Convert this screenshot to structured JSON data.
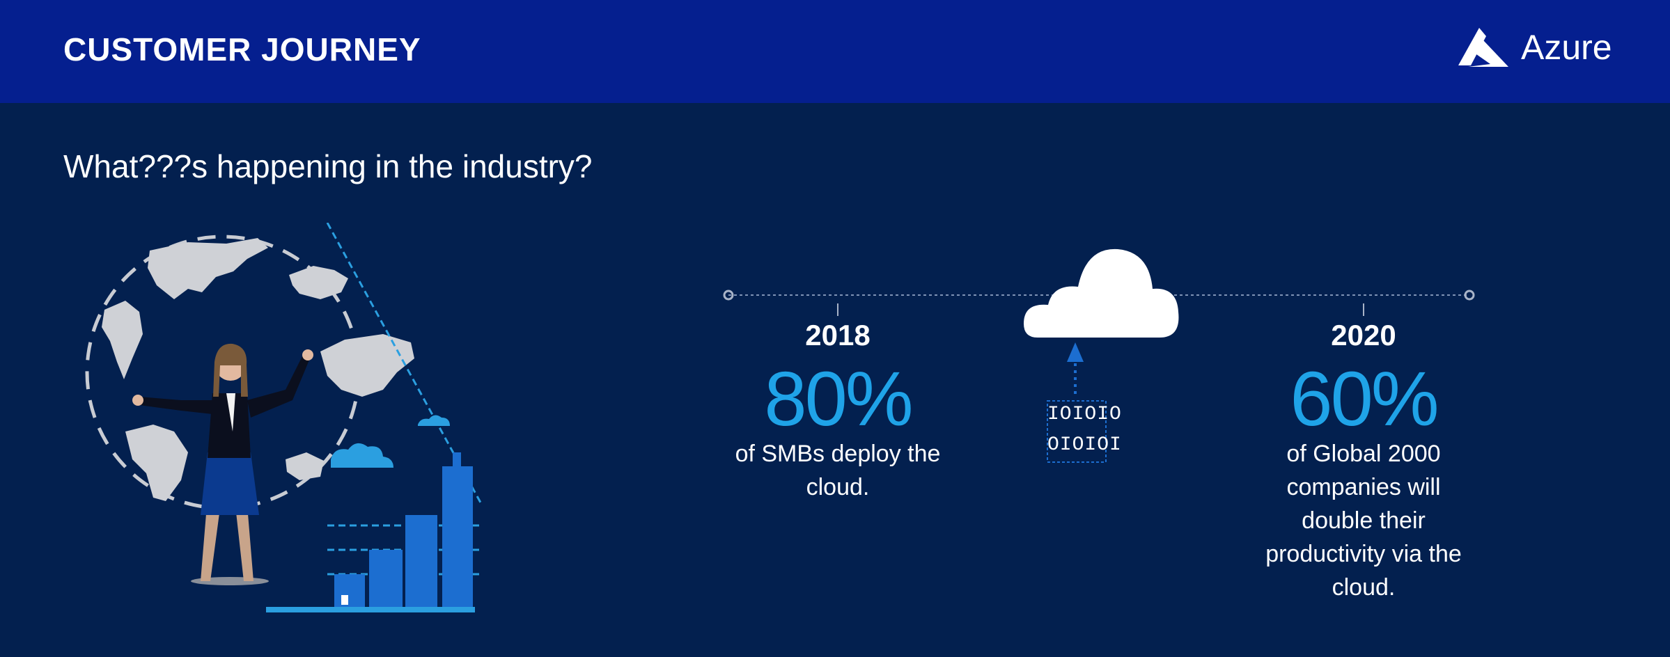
{
  "header": {
    "title": "CUSTOMER JOURNEY",
    "logo_text": "Azure"
  },
  "subtitle": "What???s happening in the industry?",
  "stats": [
    {
      "year": "2018",
      "value": "80%",
      "description": "of SMBs deploy the cloud."
    },
    {
      "year": "2020",
      "value": "60%",
      "description": "of Global 2000 companies will double their productivity via the cloud."
    }
  ],
  "binary": {
    "line1": "IOIOIO",
    "line2": "OIOIOI"
  },
  "colors": {
    "header_bg": "#051f8f",
    "page_bg": "#03204f",
    "accent": "#1fa3e8"
  },
  "icons": [
    "azure-logo-icon",
    "globe-illustration",
    "businesswoman-illustration",
    "city-buildings-illustration",
    "cloud-icon",
    "upload-arrow-icon",
    "binary-data-icon"
  ]
}
